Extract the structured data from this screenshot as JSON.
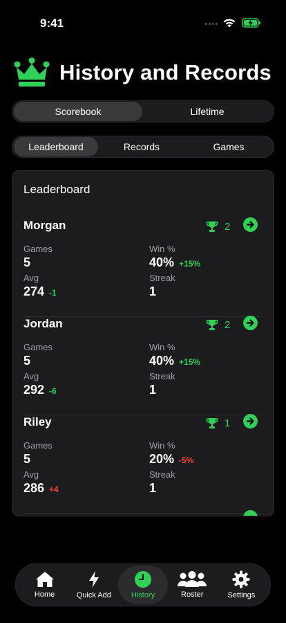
{
  "status": {
    "time": "9:41"
  },
  "header": {
    "title": "History and Records"
  },
  "top_segment": {
    "items": [
      "Scorebook",
      "Lifetime"
    ],
    "selected": "Scorebook"
  },
  "sub_segment": {
    "items": [
      "Leaderboard",
      "Records",
      "Games"
    ],
    "selected": "Leaderboard"
  },
  "leaderboard": {
    "title": "Leaderboard",
    "labels": {
      "games": "Games",
      "win": "Win %",
      "avg": "Avg",
      "streak": "Streak"
    },
    "players": [
      {
        "name": "Morgan",
        "trophies": "2",
        "games": "5",
        "win": "40%",
        "win_delta": "+15%",
        "avg": "274",
        "avg_delta": "-1",
        "streak": "1"
      },
      {
        "name": "Jordan",
        "trophies": "2",
        "games": "5",
        "win": "40%",
        "win_delta": "+15%",
        "avg": "292",
        "avg_delta": "-6",
        "streak": "1"
      },
      {
        "name": "Riley",
        "trophies": "1",
        "games": "5",
        "win": "20%",
        "win_delta": "-5%",
        "avg": "286",
        "avg_delta": "+4",
        "streak": "1"
      }
    ]
  },
  "tabbar": {
    "items": [
      {
        "label": "Home",
        "icon": "home-icon"
      },
      {
        "label": "Quick Add",
        "icon": "bolt-icon"
      },
      {
        "label": "History",
        "icon": "clock-icon"
      },
      {
        "label": "Roster",
        "icon": "people-icon"
      },
      {
        "label": "Settings",
        "icon": "gear-icon"
      }
    ],
    "selected": "History"
  },
  "colors": {
    "accent": "#30d158",
    "negative": "#ff453a",
    "card": "#1c1c1e",
    "background": "#000000"
  }
}
